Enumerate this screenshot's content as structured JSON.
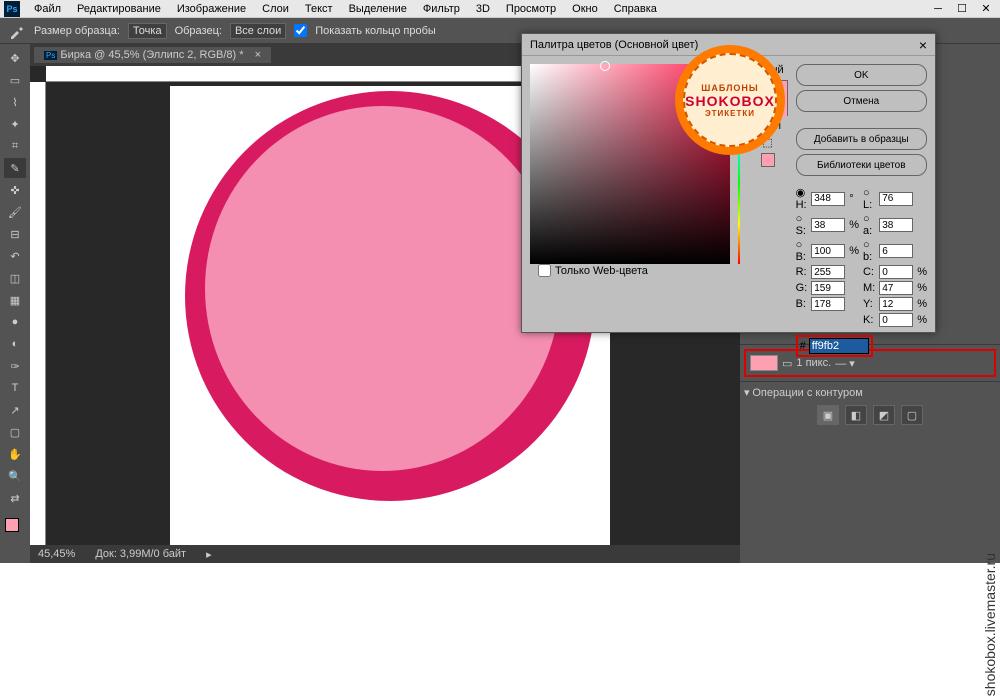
{
  "menu": {
    "items": [
      "Файл",
      "Редактирование",
      "Изображение",
      "Слои",
      "Текст",
      "Выделение",
      "Фильтр",
      "3D",
      "Просмотр",
      "Окно",
      "Справка"
    ]
  },
  "optbar": {
    "sample_label": "Размер образца:",
    "sample_val": "Точка",
    "layer_label": "Образец:",
    "layer_val": "Все слои",
    "ring_label": "Показать кольцо пробы"
  },
  "tab": {
    "icon": "Ps",
    "title": "Бирка @ 45,5% (Эллипс 2, RGB/8) *"
  },
  "status": {
    "zoom": "45,45%",
    "doc": "Док: 3,99M/0 байт"
  },
  "dialog": {
    "title": "Палитра цветов (Основной цвет)",
    "ok": "OK",
    "cancel": "Отмена",
    "add": "Добавить в образцы",
    "lib": "Библиотеки цветов",
    "new": "новый",
    "cur": "ущий",
    "webonly": "Только Web-цвета",
    "H": "348",
    "S": "38",
    "Bv": "100",
    "R": "255",
    "G": "159",
    "Bc": "178",
    "L": "76",
    "a": "38",
    "b": "6",
    "C": "0",
    "M": "47",
    "Y": "12",
    "K": "0",
    "hex": "ff9fb2"
  },
  "panel": {
    "ops_title": "Операции с контуром",
    "stroke_val": "1 пикс."
  },
  "badge": {
    "t1": "ШАБЛОНЫ",
    "t2": "SHOKOBOX",
    "t3": "ЭТИКЕТКИ"
  },
  "watermark": "shokobox.livemaster.ru",
  "tools": [
    "move",
    "marquee",
    "lasso",
    "wand",
    "crop",
    "eyedropper",
    "heal",
    "brush",
    "stamp",
    "history",
    "eraser",
    "gradient",
    "blur",
    "dodge",
    "pen",
    "type",
    "path",
    "rect",
    "hand",
    "zoom",
    "swap"
  ]
}
